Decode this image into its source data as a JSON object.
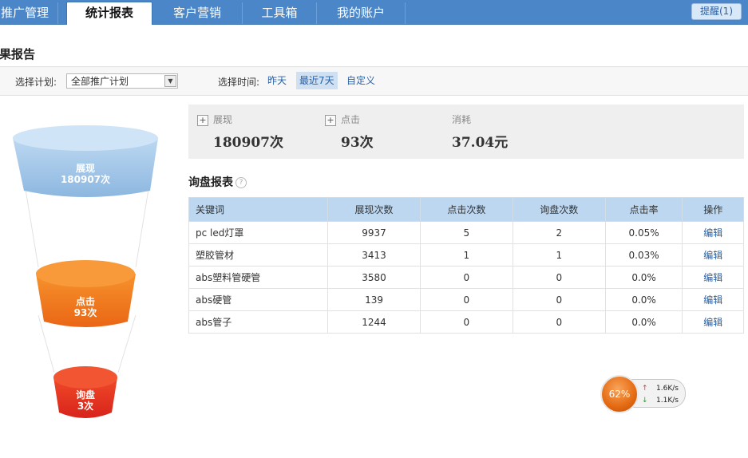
{
  "nav": {
    "tabs": [
      "推广管理",
      "统计报表",
      "客户营销",
      "工具箱",
      "我的账户"
    ],
    "active_tab": "统计报表",
    "remind": "提醒(1)"
  },
  "page_title": "效果报告",
  "filters": {
    "plan_label": "选择计划:",
    "plan_value": "全部推广计划",
    "time_label": "选择时间:",
    "time_options": [
      "昨天",
      "最近7天",
      "自定义"
    ],
    "time_selected": "最近7天"
  },
  "summary": {
    "impressions_label": "展现",
    "impressions_value": "180907次",
    "clicks_label": "点击",
    "clicks_value": "93次",
    "cost_label": "消耗",
    "cost_value": "37.04元"
  },
  "funnel": {
    "top": {
      "name": "展现",
      "value": "180907次"
    },
    "middle": {
      "name": "点击",
      "value": "93次"
    },
    "bottom": {
      "name": "询盘",
      "value": "3次"
    },
    "colors": {
      "top": "#a9cbec",
      "middle": "#f07a1e",
      "bottom": "#e8311f"
    }
  },
  "report": {
    "title": "询盘报表",
    "help_icon": "?",
    "columns": [
      "关键词",
      "展现次数",
      "点击次数",
      "询盘次数",
      "点击率",
      "操作"
    ],
    "rows": [
      [
        "pc led灯罩",
        "9937",
        "5",
        "2",
        "0.05%",
        "编辑"
      ],
      [
        "塑胶管材",
        "3413",
        "1",
        "1",
        "0.03%",
        "编辑"
      ],
      [
        "abs塑料管硬管",
        "3580",
        "0",
        "0",
        "0.0%",
        "编辑"
      ],
      [
        "abs硬管",
        "139",
        "0",
        "0",
        "0.0%",
        "编辑"
      ],
      [
        "abs管子",
        "1244",
        "0",
        "0",
        "0.0%",
        "编辑"
      ]
    ]
  },
  "speed_widget": {
    "percent": "62%",
    "up": "1.6K/s",
    "down": "1.1K/s"
  }
}
